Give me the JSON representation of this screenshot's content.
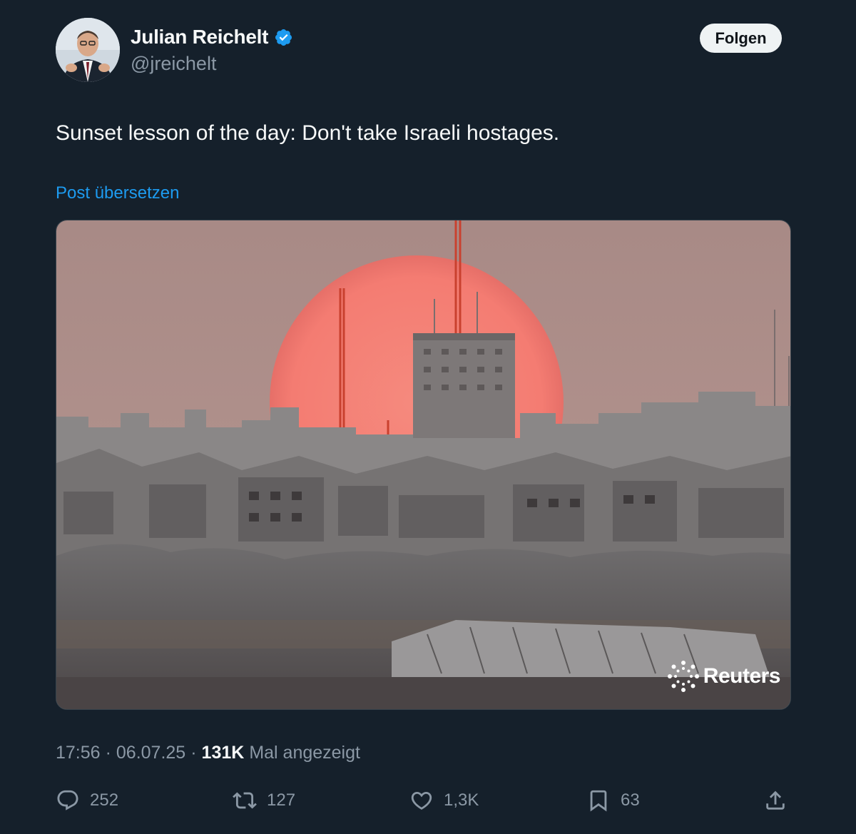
{
  "author": {
    "display_name": "Julian Reichelt",
    "handle": "@jreichelt",
    "verified": true
  },
  "follow_label": "Folgen",
  "tweet": {
    "text": "Sunset lesson of the day: Don't take Israeli hostages.",
    "translate_label": "Post übersetzen"
  },
  "media": {
    "watermark": "Reuters"
  },
  "meta": {
    "time": "17:56",
    "sep1": "·",
    "date": "06.07.25",
    "sep2": "·",
    "views": "131K",
    "views_suffix": "Mal angezeigt"
  },
  "actions": {
    "replies": "252",
    "reposts": "127",
    "likes": "1,3K",
    "bookmarks": "63"
  },
  "colors": {
    "background": "#15202b",
    "link": "#1d9bf0",
    "muted": "#8b98a5",
    "verified": "#1d9bf0"
  }
}
